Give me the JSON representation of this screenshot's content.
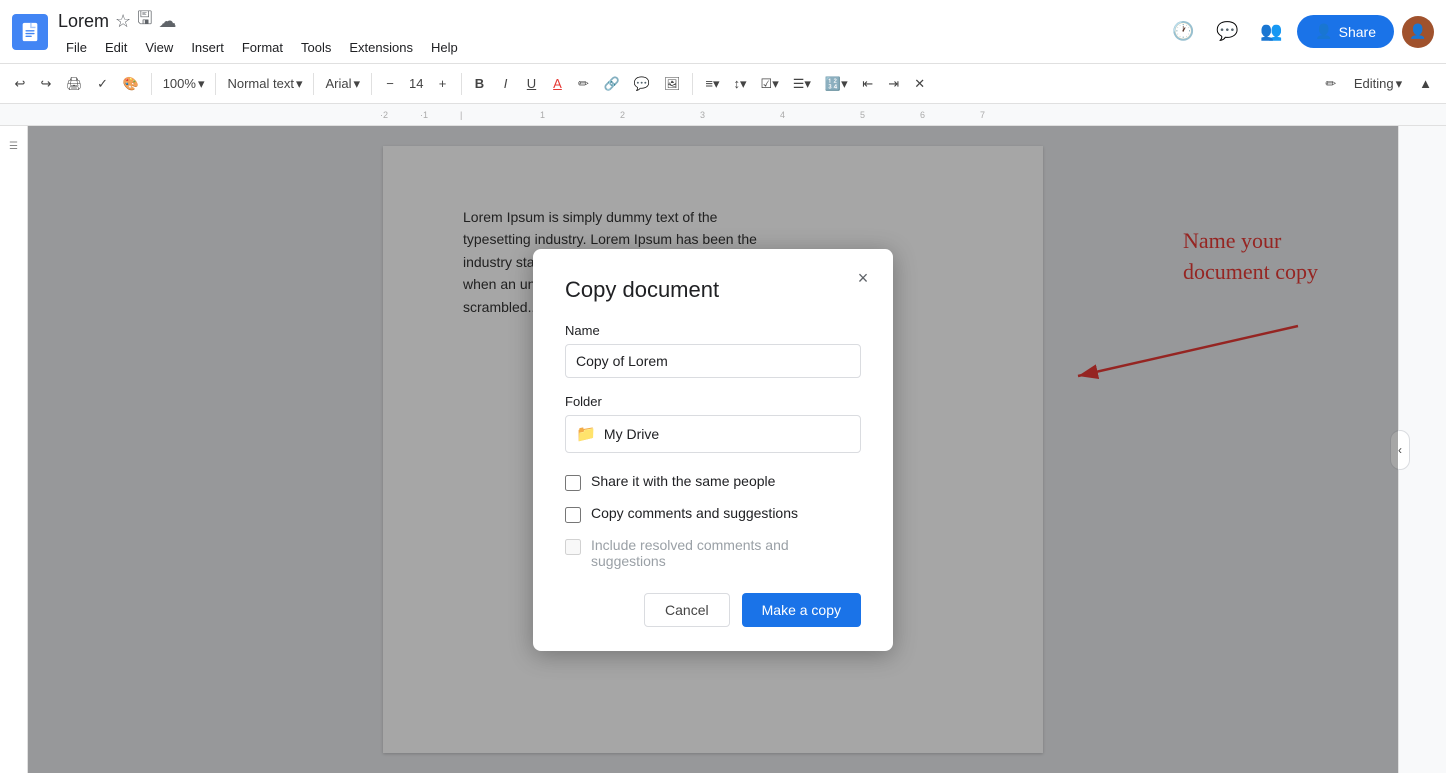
{
  "app": {
    "icon_color": "#4285f4",
    "title": "Lorem",
    "title_icons": [
      "☆",
      "🖫",
      "☁"
    ],
    "menu": [
      "File",
      "Edit",
      "View",
      "Insert",
      "Format",
      "Tools",
      "Extensions",
      "Help"
    ]
  },
  "toolbar": {
    "zoom": "100%",
    "style": "Normal text",
    "font": "Arial",
    "font_size": "14",
    "editing_mode": "Editing"
  },
  "top_right": {
    "share_label": "Share",
    "editing_label": "Editing"
  },
  "dialog": {
    "title": "Copy document",
    "close_label": "×",
    "name_label": "Name",
    "name_value": "Copy of Lorem",
    "folder_label": "Folder",
    "folder_value": "My Drive",
    "checkbox1_label": "Share it with the same people",
    "checkbox1_checked": false,
    "checkbox2_label": "Copy comments and suggestions",
    "checkbox2_checked": false,
    "checkbox3_label": "Include resolved comments and suggestions",
    "checkbox3_checked": false,
    "checkbox3_disabled": true,
    "cancel_label": "Cancel",
    "confirm_label": "Make a copy"
  },
  "annotation": {
    "text": "Name your\ndocument copy",
    "color": "#e53935"
  },
  "doc": {
    "text": "Lorem Ipsum is simply dummy text of the typesetting industry. Lorem Ipsum has been the industry standard dummy text ever since the 1500s, when an unknown printer took a galley of type and scrambled..."
  }
}
